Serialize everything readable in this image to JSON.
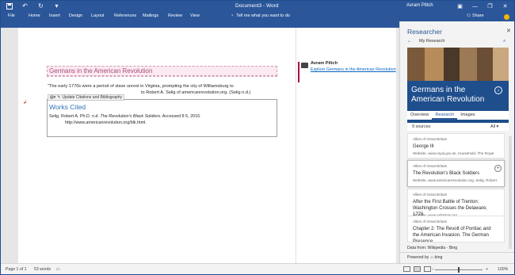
{
  "titlebar": {
    "doc_title": "Document3 - Word",
    "user_name": "Avram Piltch",
    "bg_color": "#2b579a"
  },
  "ribbon": {
    "tabs": [
      "File",
      "Home",
      "Insert",
      "Design",
      "Layout",
      "References",
      "Mailings",
      "Review",
      "View"
    ],
    "tell_me": "Tell me what you want to do",
    "share": "Share"
  },
  "document": {
    "heading": "Germans in the American Revolution",
    "paragraph": "\"The early 1770s were a period of slave unrest in Virginia, prompting the city of Williamsburg to",
    "paragraph_tail": "to Robert A. Selig of americanrevolution.org. (Selig n.d.)",
    "citation_toolbar": "Update Citations and Bibliography",
    "works_cited": "Works Cited",
    "citation_line1": "Selig, Robert A. Ph.D. n.d. ",
    "citation_italic": "The Revolution's Black Soldiers",
    "citation_line1_end": ". Accessed 8 5, 2016.",
    "citation_line2": "http://www.americanrevolution.org/blk.html.",
    "comment_author": "Avram Piltch",
    "comment_link": "Explore Germans in the American Revolution"
  },
  "researcher": {
    "title": "Researcher",
    "my_research": "My Research",
    "hero_title": "Germans in the American Revolution",
    "tabs": [
      "Overview",
      "Research",
      "Images"
    ],
    "active_tab": "Research",
    "sources_count": "9 sources",
    "filter": "All",
    "cards": [
      {
        "category": "Allies of Great Britain",
        "title": "George III",
        "meta": "Website, www.royal.gov.uk, Household, The Royal"
      },
      {
        "category": "Allies of Great Britain",
        "title": "The Revolution's Black Soldiers",
        "meta": "Website, www.americanrevolution.org, Selig, Robert"
      },
      {
        "category": "Allies of Great Britain",
        "title": "After the First Battle of Trenton: Washington Crosses the Delaware, 1776",
        "meta": "Website, www.ushistory.org"
      },
      {
        "category": "Allies of Great Britain",
        "title": "Chapter 2: The Revolt of Pontiac and the American Invasion. The German Presence.",
        "meta": "Website, www.army.gc.ca"
      }
    ],
    "data_from": "Data from: Wikipedia · Bing",
    "powered_by": "Powered by",
    "bing": "bing"
  },
  "statusbar": {
    "page": "Page 1 of 1",
    "words": "53 words",
    "zoom": "100%"
  }
}
